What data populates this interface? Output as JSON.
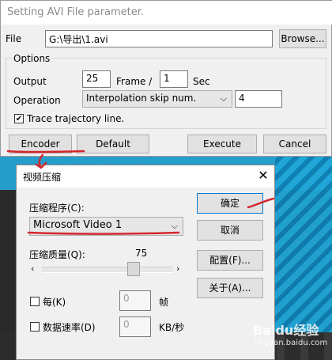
{
  "main": {
    "title": "Setting AVI File parameter.",
    "file_label": "File",
    "file_value": "G:\\导出\\1.avi",
    "browse_label": "Browse...",
    "options_label": "Options",
    "output_label": "Output",
    "output_value": "25",
    "frame_label": "Frame /",
    "sec_value": "1",
    "sec_label": "Sec",
    "operation_label": "Operation",
    "operation_value": "Interpolation skip num.",
    "operation_num": "4",
    "trace_label": "Trace trajectory line.",
    "trace_checked": true,
    "encoder_label": "Encoder",
    "default_label": "Default",
    "execute_label": "Execute",
    "cancel_label": "Cancel"
  },
  "compress": {
    "title": "视频压缩",
    "compressor_label": "压缩程序(C):",
    "compressor_value": "Microsoft Video 1",
    "quality_label": "压缩质量(Q):",
    "quality_value": "75",
    "quality_level": 75,
    "every_label": "每(K)",
    "every_value": "0",
    "every_unit": "帧",
    "datarate_label": "数据速率(D)",
    "datarate_value": "0",
    "datarate_unit": "KB/秒",
    "ok_label": "确定",
    "cancel_label": "取消",
    "config_label": "配置(F)...",
    "about_label": "关于(A)..."
  },
  "watermark": {
    "text": "Baidu经验",
    "url": "jingyan.baidu.com"
  },
  "colors": {
    "accent_red": "#d4262e",
    "default_border": "#0078d7",
    "scene_blue": "#1fa6d8"
  }
}
